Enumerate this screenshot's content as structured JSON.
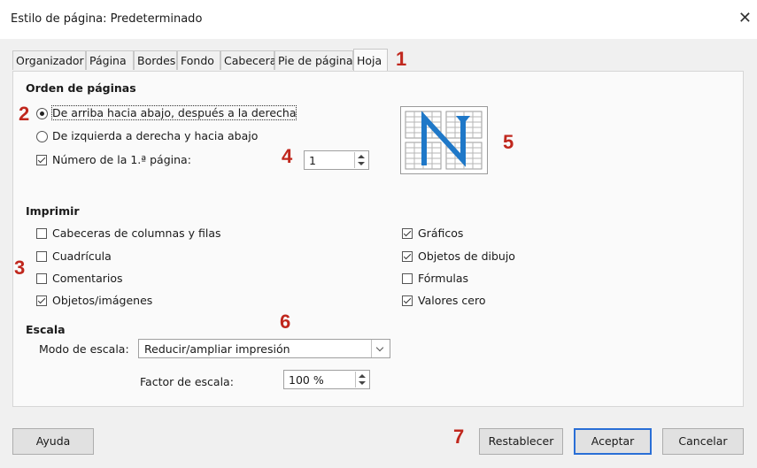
{
  "window": {
    "title": "Estilo de página: Predeterminado",
    "close_glyph": "✕"
  },
  "tabs": [
    {
      "label": "Organizador"
    },
    {
      "label": "Página"
    },
    {
      "label": "Bordes"
    },
    {
      "label": "Fondo"
    },
    {
      "label": "Cabecera"
    },
    {
      "label": "Pie de página"
    },
    {
      "label": "Hoja",
      "active": true
    }
  ],
  "page_order": {
    "heading": "Orden de páginas",
    "option_top_down": "De arriba hacia abajo, después a la derecha",
    "option_left_right": "De izquierda a derecha y hacia abajo",
    "first_page_label": "Número de la 1.ª página:",
    "first_page_value": "1"
  },
  "print": {
    "heading": "Imprimir",
    "left": [
      {
        "label": "Cabeceras de columnas y filas",
        "checked": false
      },
      {
        "label": "Cuadrícula",
        "checked": false
      },
      {
        "label": "Comentarios",
        "checked": false
      },
      {
        "label": "Objetos/imágenes",
        "checked": true
      }
    ],
    "right": [
      {
        "label": "Gráficos",
        "checked": true
      },
      {
        "label": "Objetos de dibujo",
        "checked": true
      },
      {
        "label": "Fórmulas",
        "checked": false
      },
      {
        "label": "Valores cero",
        "checked": true
      }
    ]
  },
  "scale": {
    "heading": "Escala",
    "mode_label": "Modo de escala:",
    "mode_value": "Reducir/ampliar impresión",
    "factor_label": "Factor de escala:",
    "factor_value": "100 %"
  },
  "buttons": {
    "help": "Ayuda",
    "reset": "Restablecer",
    "ok": "Aceptar",
    "cancel": "Cancelar"
  },
  "annotations": [
    "1",
    "2",
    "3",
    "4",
    "5",
    "6",
    "7"
  ],
  "colors": {
    "annotation": "#c0271d",
    "arrow": "#1f78c8"
  }
}
